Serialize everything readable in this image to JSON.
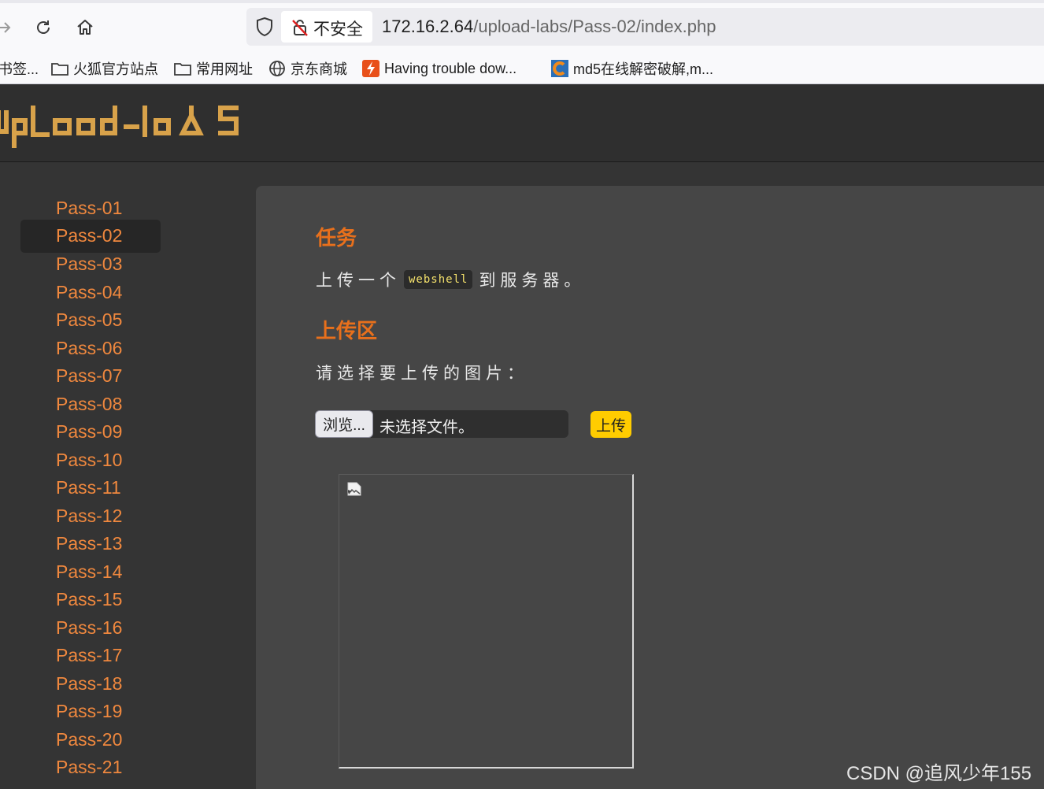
{
  "browser": {
    "insecure_label": "不安全",
    "url_host": "172.16.2.64",
    "url_path": "/upload-labs/Pass-02/index.php",
    "bookmarks": [
      {
        "label": "书签...",
        "icon": "none"
      },
      {
        "label": "火狐官方站点",
        "icon": "folder-icon"
      },
      {
        "label": "常用网址",
        "icon": "folder-icon"
      },
      {
        "label": "京东商城",
        "icon": "globe-icon"
      },
      {
        "label": "Having trouble dow...",
        "icon": "flash-icon"
      },
      {
        "label": "md5在线解密破解,m...",
        "icon": "cmd5-icon"
      }
    ]
  },
  "header": {
    "logo_text": "upload-labs"
  },
  "sidebar": {
    "active": "Pass-02",
    "items": [
      "Pass-01",
      "Pass-02",
      "Pass-03",
      "Pass-04",
      "Pass-05",
      "Pass-06",
      "Pass-07",
      "Pass-08",
      "Pass-09",
      "Pass-10",
      "Pass-11",
      "Pass-12",
      "Pass-13",
      "Pass-14",
      "Pass-15",
      "Pass-16",
      "Pass-17",
      "Pass-18",
      "Pass-19",
      "Pass-20",
      "Pass-21"
    ]
  },
  "main": {
    "task_title": "任务",
    "task_before": "上传一个",
    "task_code": "webshell",
    "task_after": "到服务器。",
    "upload_title": "上传区",
    "pick_label": "请选择要上传的图片：",
    "browse_label": "浏览...",
    "no_file_label": "未选择文件。",
    "upload_button": "上传"
  },
  "watermark": "CSDN @追风少年155",
  "colors": {
    "accent": "#e8701c",
    "link": "#f0883e",
    "upload_button": "#ffcc00",
    "code_text": "#f5e26c"
  }
}
